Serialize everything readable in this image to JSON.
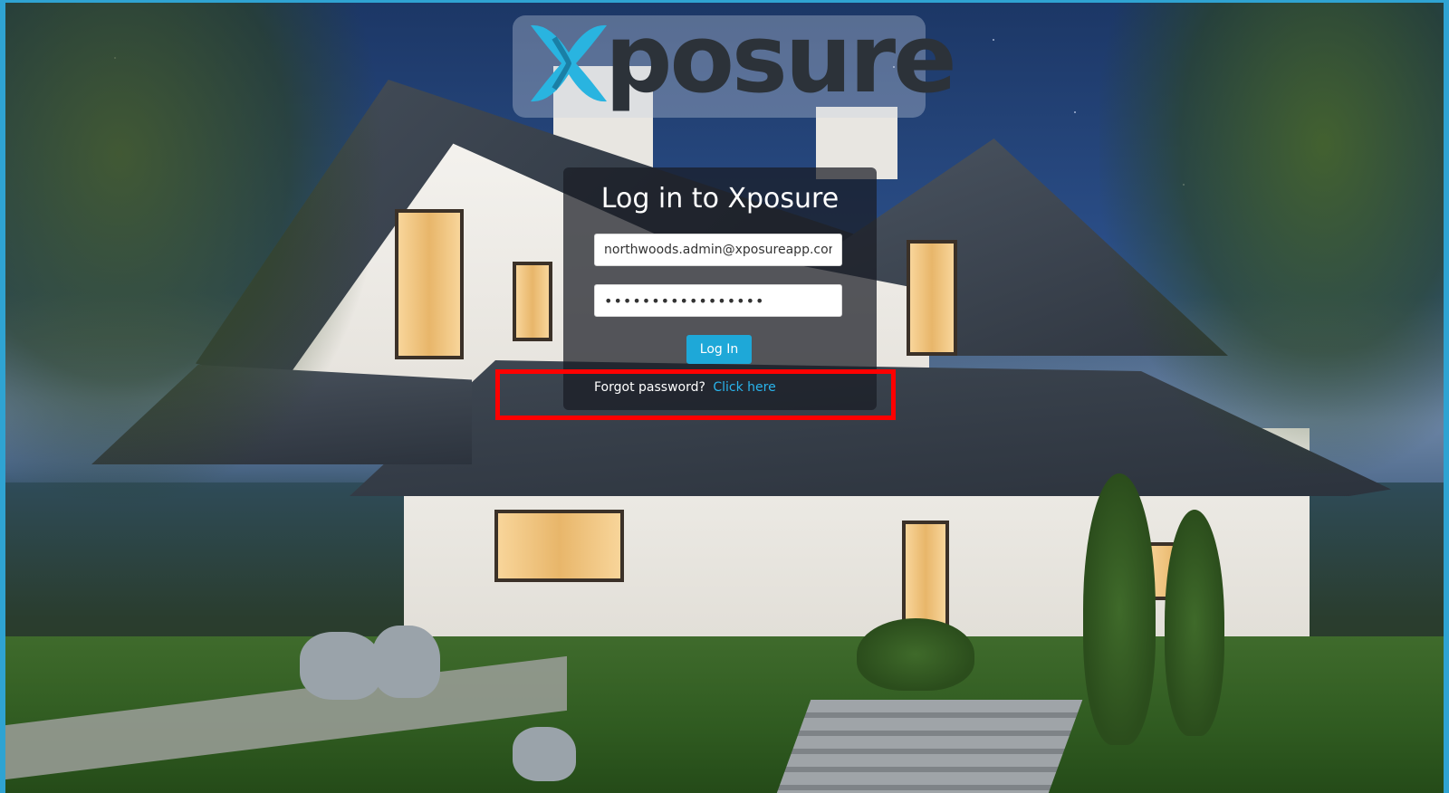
{
  "brand": {
    "logo_text": "posure",
    "logo_x_color": "#29b4e0",
    "logo_text_color": "#2c3239"
  },
  "login": {
    "title": "Log in to Xposure",
    "email_value": "northwoods.admin@xposureapp.com",
    "password_value": "•••••••••••••••••",
    "submit_label": "Log In",
    "forgot_text": "Forgot password?",
    "forgot_link": "Click here"
  },
  "colors": {
    "accent": "#1ea8d8",
    "link": "#29b4ec",
    "highlight_border": "#ff0000"
  }
}
